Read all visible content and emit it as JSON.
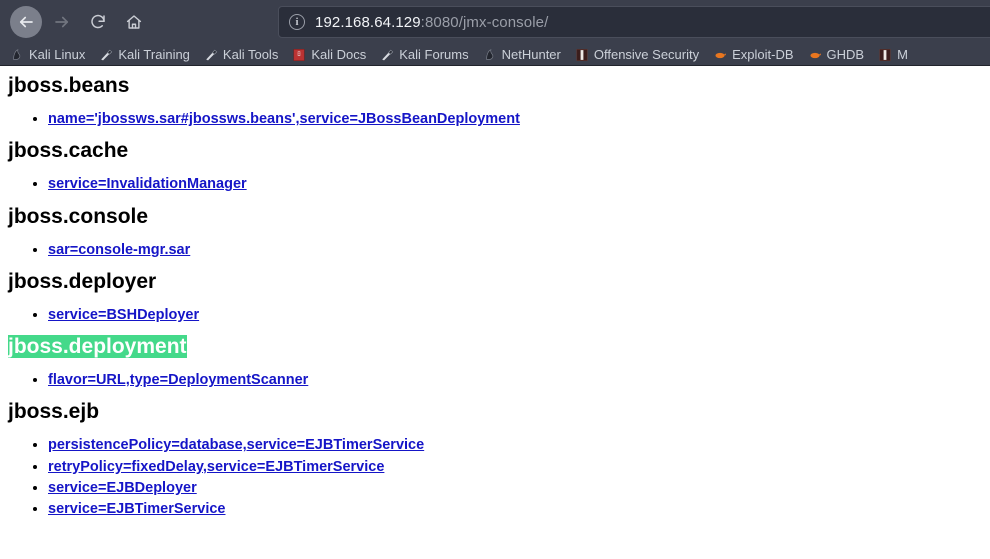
{
  "browser": {
    "toolbar": {
      "back_icon": "arrow-left-icon",
      "forward_icon": "arrow-right-icon",
      "reload_icon": "reload-icon",
      "home_icon": "home-icon"
    },
    "address_bar": {
      "info_icon": "site-info-icon",
      "info_glyph": "i",
      "host": "192.168.64.129",
      "path": ":8080/jmx-console/",
      "full_url": "192.168.64.129:8080/jmx-console/"
    },
    "bookmarks": [
      {
        "label": "Kali Linux",
        "icon": "kali-dragon-icon"
      },
      {
        "label": "Kali Training",
        "icon": "kali-tool-icon"
      },
      {
        "label": "Kali Tools",
        "icon": "kali-tool-icon"
      },
      {
        "label": "Kali Docs",
        "icon": "kali-docs-book-icon"
      },
      {
        "label": "Kali Forums",
        "icon": "kali-tool-icon"
      },
      {
        "label": "NetHunter",
        "icon": "kali-dragon-icon"
      },
      {
        "label": "Offensive Security",
        "icon": "offsec-icon"
      },
      {
        "label": "Exploit-DB",
        "icon": "exploitdb-icon"
      },
      {
        "label": "GHDB",
        "icon": "exploitdb-icon"
      },
      {
        "label": "M",
        "icon": "offsec-icon"
      }
    ]
  },
  "colors": {
    "chrome_bg": "#3b3f4c",
    "urlbar_bg": "#2a2e3a",
    "link": "#1515c7",
    "selection_bg": "#44d98a",
    "selection_fg": "#ffffff"
  },
  "page": {
    "groups": [
      {
        "domain": "jboss.beans",
        "highlighted": false,
        "links": [
          "name='jbossws.sar#jbossws.beans',service=JBossBeanDeployment"
        ]
      },
      {
        "domain": "jboss.cache",
        "highlighted": false,
        "links": [
          "service=InvalidationManager"
        ]
      },
      {
        "domain": "jboss.console",
        "highlighted": false,
        "links": [
          "sar=console-mgr.sar"
        ]
      },
      {
        "domain": "jboss.deployer",
        "highlighted": false,
        "links": [
          "service=BSHDeployer"
        ]
      },
      {
        "domain": "jboss.deployment",
        "highlighted": true,
        "links": [
          "flavor=URL,type=DeploymentScanner"
        ]
      },
      {
        "domain": "jboss.ejb",
        "highlighted": false,
        "links": [
          "persistencePolicy=database,service=EJBTimerService",
          "retryPolicy=fixedDelay,service=EJBTimerService",
          "service=EJBDeployer",
          "service=EJBTimerService"
        ]
      }
    ]
  }
}
